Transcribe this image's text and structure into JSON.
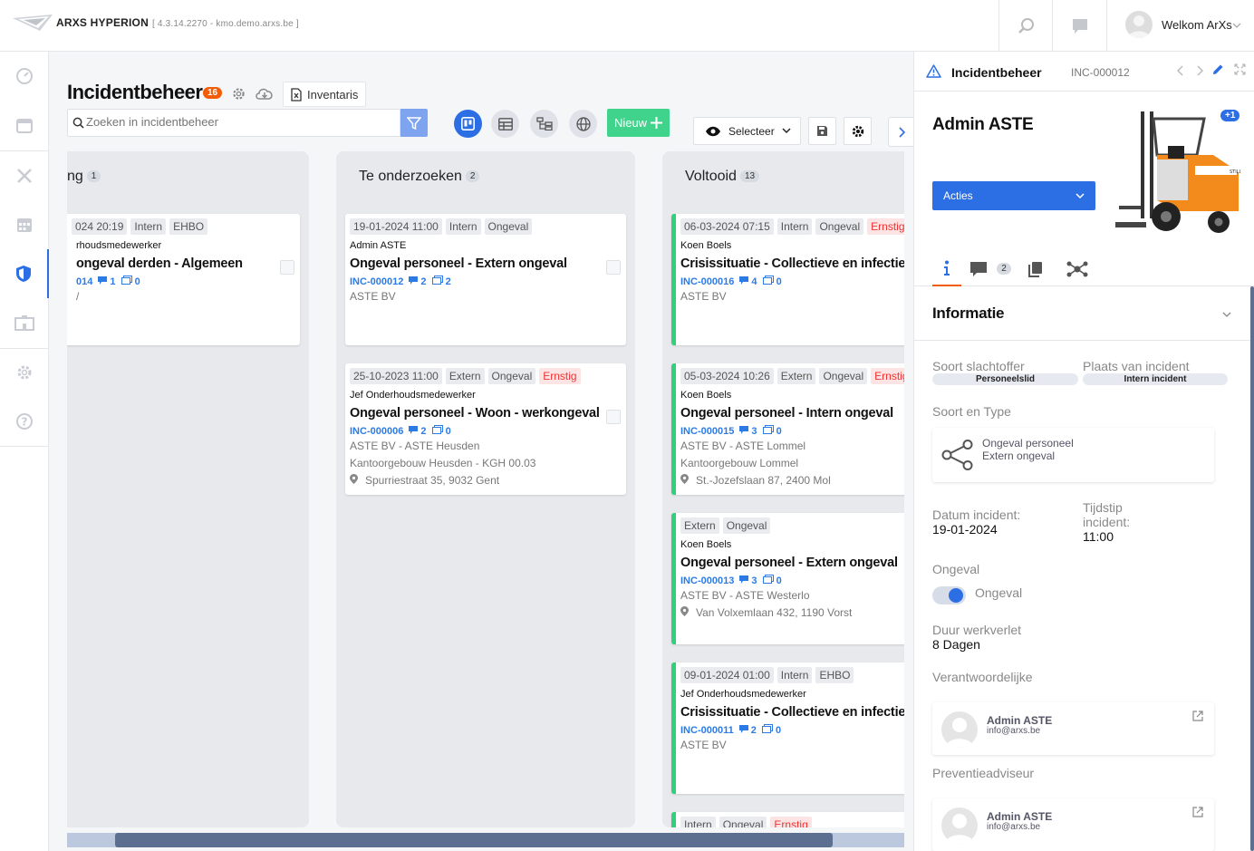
{
  "app": {
    "name": "ARXS HYPERION",
    "version": "[ 4.3.14.2270 - kmo.demo.arxs.be ]"
  },
  "topbar": {
    "user_greeting": "Welkom ArXs"
  },
  "page": {
    "title": "Incidentbeheer",
    "count": "16",
    "inventaris_label": "Inventaris",
    "search_placeholder": "Zoeken in incidentbeheer",
    "new_label": "Nieuw",
    "select_label": "Selecteer"
  },
  "columns": [
    {
      "title": "ng",
      "count": "1",
      "cards": [
        {
          "tags": [
            {
              "t": "024 20:19"
            },
            {
              "t": "Intern"
            },
            {
              "t": "EHBO"
            }
          ],
          "user": "rhoudsmedewerker",
          "title": "ongeval derden - Algemeen",
          "id": "014",
          "comments": "1",
          "images": "0",
          "lines": [
            "/"
          ]
        }
      ]
    },
    {
      "title": "Te onderzoeken",
      "count": "2",
      "cards": [
        {
          "tags": [
            {
              "t": "19-01-2024 11:00"
            },
            {
              "t": "Intern"
            },
            {
              "t": "Ongeval"
            }
          ],
          "user": "Admin ASTE",
          "title": "Ongeval personeel - Extern ongeval",
          "id": "INC-000012",
          "comments": "2",
          "images": "2",
          "lines": [
            "ASTE BV"
          ]
        },
        {
          "tags": [
            {
              "t": "25-10-2023 11:00"
            },
            {
              "t": "Extern"
            },
            {
              "t": "Ongeval"
            },
            {
              "t": "Ernstig",
              "red": true
            }
          ],
          "user": "Jef Onderhoudsmedewerker",
          "title": "Ongeval personeel - Woon - werkongeval",
          "id": "INC-000006",
          "comments": "2",
          "images": "0",
          "lines": [
            "ASTE BV - ASTE Heusden",
            "Kantoorgebouw Heusden - KGH 00.03"
          ],
          "address": "Spurriestraat 35, 9032 Gent"
        }
      ]
    },
    {
      "title": "Voltooid",
      "count": "13",
      "cards": [
        {
          "tags": [
            {
              "t": "06-03-2024 07:15"
            },
            {
              "t": "Intern"
            },
            {
              "t": "Ongeval"
            },
            {
              "t": "Ernstig",
              "red": true
            }
          ],
          "user": "Koen Boels",
          "title": "Crisissituatie - Collectieve en infectieziekt",
          "id": "INC-000016",
          "comments": "4",
          "images": "0",
          "lines": [
            "ASTE BV"
          ]
        },
        {
          "tags": [
            {
              "t": "05-03-2024 10:26"
            },
            {
              "t": "Extern"
            },
            {
              "t": "Ongeval"
            },
            {
              "t": "Ernstig",
              "red": true
            }
          ],
          "user": "Koen Boels",
          "title": "Ongeval personeel - Intern ongeval",
          "id": "INC-000015",
          "comments": "3",
          "images": "0",
          "lines": [
            "ASTE BV - ASTE Lommel",
            "Kantoorgebouw Lommel"
          ],
          "address": "St.-Jozefslaan 87, 2400 Mol"
        },
        {
          "tags": [
            {
              "t": "Extern"
            },
            {
              "t": "Ongeval"
            }
          ],
          "user": "Koen Boels",
          "title": "Ongeval personeel - Extern ongeval",
          "id": "INC-000013",
          "comments": "3",
          "images": "0",
          "lines": [
            "ASTE BV - ASTE Westerlo"
          ],
          "address": "Van Volxemlaan 432, 1190 Vorst"
        },
        {
          "tags": [
            {
              "t": "09-01-2024 01:00"
            },
            {
              "t": "Intern"
            },
            {
              "t": "EHBO"
            }
          ],
          "user": "Jef Onderhoudsmedewerker",
          "title": "Crisissituatie - Collectieve en infectieziekt",
          "id": "INC-000011",
          "comments": "2",
          "images": "0",
          "lines": [
            "ASTE BV"
          ]
        },
        {
          "tags": [
            {
              "t": "Intern"
            },
            {
              "t": "Ongeval"
            },
            {
              "t": "Ernstig",
              "red": true
            }
          ],
          "user": "",
          "title": "",
          "id": "",
          "comments": "",
          "images": "",
          "lines": []
        }
      ]
    }
  ],
  "panel": {
    "title": "Incidentbeheer",
    "id": "INC-000012",
    "name": "Admin ASTE",
    "acties_label": "Acties",
    "image_extra": "+1",
    "comments_count": "2",
    "section_title": "Informatie",
    "soort_slachtoffer_label": "Soort slachtoffer",
    "soort_slachtoffer_value": "Personeelslid",
    "plaats_label": "Plaats van incident",
    "plaats_value": "Intern incident",
    "soort_type_label": "Soort en Type",
    "soort_value": "Ongeval personeel",
    "type_value": "Extern ongeval",
    "datum_label": "Datum incident:",
    "datum_value": "19-01-2024",
    "tijdstip_label_1": "Tijdstip",
    "tijdstip_label_2": "incident:",
    "tijdstip_value": "11:00",
    "ongeval_label": "Ongeval",
    "ongeval_toggle_label": "Ongeval",
    "duur_label": "Duur werkverlet",
    "duur_value": "8 Dagen",
    "verantwoordelijke_label": "Verantwoordelijke",
    "verantwoordelijke_name": "Admin ASTE",
    "verantwoordelijke_mail": "info@arxs.be",
    "preventie_label": "Preventieadviseur",
    "preventie_name": "Admin ASTE",
    "preventie_mail": "info@arxs.be"
  },
  "colors": {
    "accent": "#2c6fe5",
    "orange": "#f25c05",
    "green": "#3fd38c",
    "ernstig": "#e33333"
  }
}
